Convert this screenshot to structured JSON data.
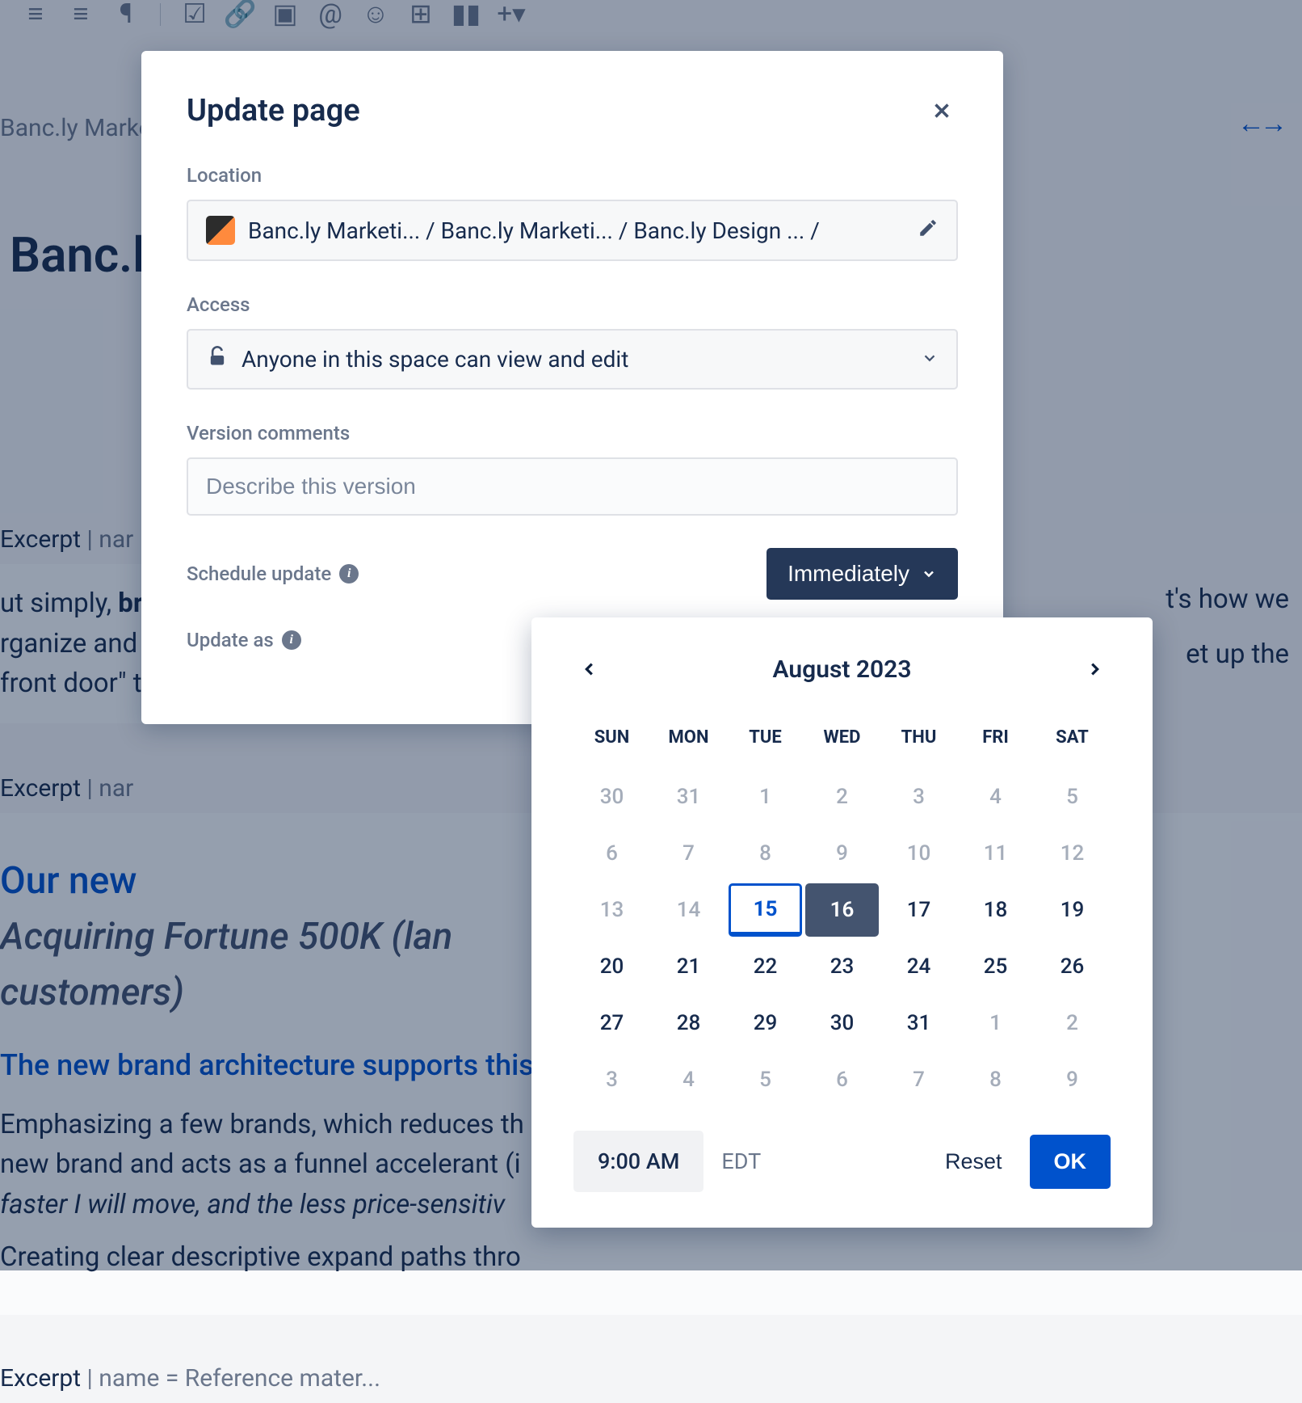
{
  "bg": {
    "breadcrumb": "Banc.ly Marke",
    "title": "Banc.l",
    "expandGlyph": "↔",
    "excerpt1_head": "Excerpt",
    "excerpt1_name": " | nar",
    "excerpt1_body_a": "ut simply, ",
    "excerpt1_body_bold": "bra",
    "excerpt1_body_b": "rganize and b",
    "excerpt1_body_c": "front door\" to",
    "tail_a": "t's how we",
    "tail_b": "et up the",
    "excerpt2_head": "Excerpt",
    "excerpt2_name": " | nar",
    "h2a": "Our new",
    "h2b": "Acquiring Fortune 500K (lan",
    "h2c": "customers)",
    "h3": "The new brand architecture supports this am",
    "li1a": "Emphasizing a few brands, which reduces th",
    "li1b": "new brand and acts as a funnel accelerant (i",
    "li1c": "faster I will move, and the less price-sensitiv",
    "li2": "Creating clear descriptive expand paths thro",
    "excerpt3_head": "Excerpt",
    "excerpt3_name": " | name = Reference mater..."
  },
  "dialog": {
    "title": "Update page",
    "location_label": "Location",
    "location_path": "Banc.ly Marketi... / Banc.ly Marketi... / Banc.ly Design ... /",
    "access_label": "Access",
    "access_value": "Anyone in this space can view and edit",
    "version_label": "Version comments",
    "version_placeholder": "Describe this version",
    "schedule_label": "Schedule update",
    "schedule_btn": "Immediately",
    "update_as_label": "Update as"
  },
  "calendar": {
    "month": "August 2023",
    "dow": [
      "SUN",
      "MON",
      "TUE",
      "WED",
      "THU",
      "FRI",
      "SAT"
    ],
    "days": [
      {
        "n": "30",
        "muted": true
      },
      {
        "n": "31",
        "muted": true
      },
      {
        "n": "1",
        "muted": true
      },
      {
        "n": "2",
        "muted": true
      },
      {
        "n": "3",
        "muted": true
      },
      {
        "n": "4",
        "muted": true
      },
      {
        "n": "5",
        "muted": true
      },
      {
        "n": "6",
        "muted": true
      },
      {
        "n": "7",
        "muted": true
      },
      {
        "n": "8",
        "muted": true
      },
      {
        "n": "9",
        "muted": true
      },
      {
        "n": "10",
        "muted": true
      },
      {
        "n": "11",
        "muted": true
      },
      {
        "n": "12",
        "muted": true
      },
      {
        "n": "13",
        "muted": true
      },
      {
        "n": "14",
        "muted": true
      },
      {
        "n": "15",
        "today": true
      },
      {
        "n": "16",
        "selected": true
      },
      {
        "n": "17"
      },
      {
        "n": "18"
      },
      {
        "n": "19"
      },
      {
        "n": "20"
      },
      {
        "n": "21"
      },
      {
        "n": "22"
      },
      {
        "n": "23"
      },
      {
        "n": "24"
      },
      {
        "n": "25"
      },
      {
        "n": "26"
      },
      {
        "n": "27"
      },
      {
        "n": "28"
      },
      {
        "n": "29"
      },
      {
        "n": "30"
      },
      {
        "n": "31"
      },
      {
        "n": "1",
        "muted": true
      },
      {
        "n": "2",
        "muted": true
      },
      {
        "n": "3",
        "muted": true
      },
      {
        "n": "4",
        "muted": true
      },
      {
        "n": "5",
        "muted": true
      },
      {
        "n": "6",
        "muted": true
      },
      {
        "n": "7",
        "muted": true
      },
      {
        "n": "8",
        "muted": true
      },
      {
        "n": "9",
        "muted": true
      }
    ],
    "time": "9:00 AM",
    "tz": "EDT",
    "reset": "Reset",
    "ok": "OK"
  }
}
